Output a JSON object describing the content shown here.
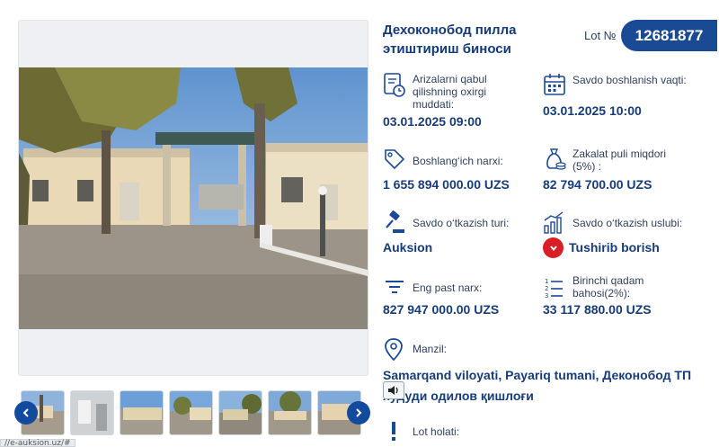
{
  "lot": {
    "title": "Дехоконобод пилла этиштириш биноси",
    "number_label": "Lot №",
    "number": "12681877"
  },
  "details": {
    "deadline": {
      "label": "Arizalarni qabul qilishning oxirgi muddati:",
      "value": "03.01.2025 09:00",
      "icon": "document-clock-icon"
    },
    "auction_start": {
      "label": "Savdo boshlanish vaqti:",
      "value": "03.01.2025 10:00",
      "icon": "calendar-icon"
    },
    "start_price": {
      "label": "Boshlang‘ich narxi:",
      "value": "1 655 894 000.00 UZS",
      "icon": "price-tag-icon"
    },
    "deposit": {
      "label": "Zakalat puli miqdori (5%) :",
      "value": "82 794 700.00 UZS",
      "icon": "money-bag-icon"
    },
    "auction_type": {
      "label": "Savdo o‘tkazish turi:",
      "value": "Auksion",
      "icon": "gavel-icon"
    },
    "auction_method": {
      "label": "Savdo o‘tkazish uslubi:",
      "value": "Tushirib borish",
      "icon": "bar-chart-icon",
      "status_color": "#d81f26"
    },
    "min_price": {
      "label": "Eng past narx:",
      "value": "827 947 000.00 UZS",
      "icon": "filter-lines-icon"
    },
    "first_step": {
      "label": "Birinchi qadam bahosi(2%):",
      "value": "33 117 880.00 UZS",
      "icon": "numbered-list-icon"
    },
    "address": {
      "label": "Manzil:",
      "value": "Samarqand viloyati, Payariq tumani, Деконобод ТП худуди одилов қишлоғи",
      "icon": "location-pin-icon"
    },
    "lot_status": {
      "label": "Lot holati:",
      "icon": "exclamation-icon"
    }
  },
  "gallery": {
    "thumbnail_count": 7,
    "prev_icon": "chevron-left-icon",
    "next_icon": "chevron-right-icon"
  },
  "status_bar": {
    "url": "//e-auksion.uz/#"
  },
  "colors": {
    "brand": "#1b4a94",
    "text": "#163c7a",
    "accent_red": "#d81f26"
  }
}
